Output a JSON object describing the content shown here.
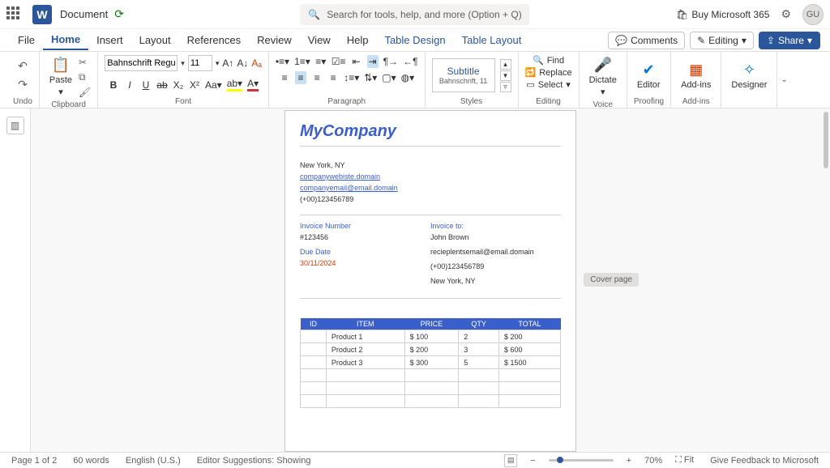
{
  "app": {
    "title": "Document",
    "avatar": "GU",
    "search_placeholder": "Search for tools, help, and more (Option + Q)",
    "buy_label": "Buy Microsoft 365"
  },
  "tabs": {
    "file": "File",
    "home": "Home",
    "insert": "Insert",
    "layout": "Layout",
    "references": "References",
    "review": "Review",
    "view": "View",
    "help": "Help",
    "table_design": "Table Design",
    "table_layout": "Table Layout",
    "comments": "Comments",
    "editing": "Editing",
    "share": "Share"
  },
  "ribbon": {
    "undo": "Undo",
    "clipboard": "Clipboard",
    "paste": "Paste",
    "font": "Font",
    "font_name": "Bahnschrift Regular",
    "font_size": "11",
    "paragraph": "Paragraph",
    "styles": "Styles",
    "style_preview_title": "Subtitle",
    "style_preview_sub": "Bahnschrift, 11",
    "editing_group": "Editing",
    "find": "Find",
    "replace": "Replace",
    "select": "Select",
    "dictate": "Dictate",
    "voice": "Voice",
    "editor": "Editor",
    "proofing": "Proofing",
    "addins": "Add-ins",
    "addins_group": "Add-ins",
    "designer": "Designer"
  },
  "doc": {
    "company": "MyCompany",
    "addr": "New York, NY",
    "website": "companywebiste.domain",
    "email": "companyemail@email.domain",
    "phone": "(+00)123456789",
    "invoice_number_label": "Invoice Number",
    "invoice_number": "#123456",
    "due_date_label": "Due Date",
    "due_date": "30/11/2024",
    "invoice_to_label": "Invoice to:",
    "recipient_name": "John Brown",
    "recipient_email": "recieplentsemail@email.domain",
    "recipient_phone": "(+00)123456789",
    "recipient_addr": "New York, NY",
    "cover": "Cover page",
    "headers": {
      "id": "ID",
      "item": "ITEM",
      "price": "PRICE",
      "qty": "QTY",
      "total": "TOTAL"
    },
    "rows": [
      {
        "item": "Product 1",
        "price": "$ 100",
        "qty": "2",
        "total": "$ 200"
      },
      {
        "item": "Product 2",
        "price": "$ 200",
        "qty": "3",
        "total": "$ 600"
      },
      {
        "item": "Product 3",
        "price": "$ 300",
        "qty": "5",
        "total": "$ 1500"
      }
    ]
  },
  "status": {
    "page": "Page 1 of 2",
    "words": "60 words",
    "lang": "English (U.S.)",
    "suggestions": "Editor Suggestions: Showing",
    "zoom": "70%",
    "fit": "Fit",
    "feedback": "Give Feedback to Microsoft"
  }
}
